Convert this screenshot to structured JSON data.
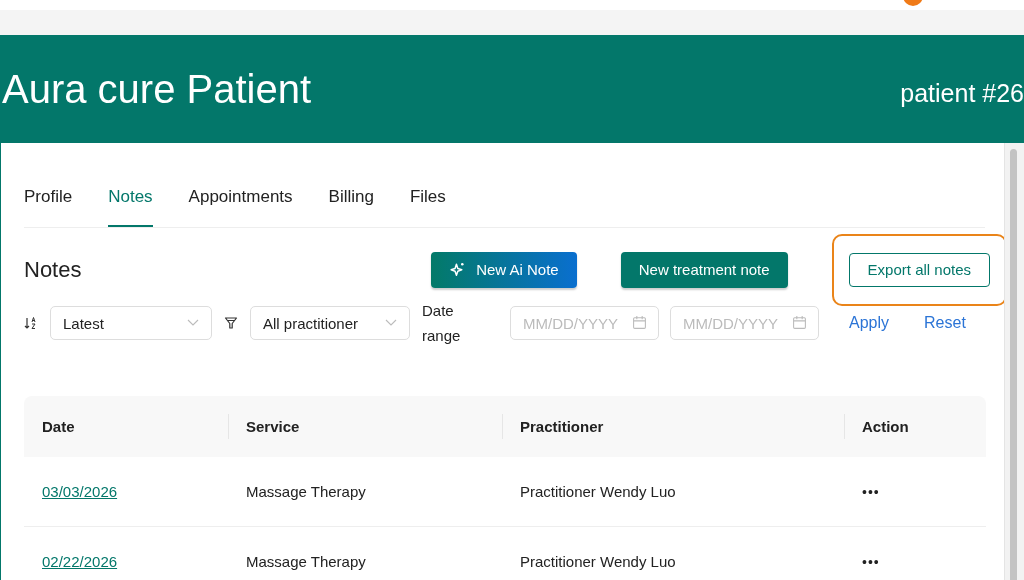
{
  "header": {
    "title": "Aura cure Patient",
    "patient_id": "patient #26"
  },
  "tabs": [
    {
      "label": "Profile",
      "selected": false
    },
    {
      "label": "Notes",
      "selected": true
    },
    {
      "label": "Appointments",
      "selected": false
    },
    {
      "label": "Billing",
      "selected": false
    },
    {
      "label": "Files",
      "selected": false
    }
  ],
  "section_title": "Notes",
  "buttons": [
    {
      "kind": "ai",
      "label": "New Ai Note"
    },
    {
      "kind": "primary",
      "label": "New treatment note"
    },
    {
      "kind": "outline",
      "label": "Export all notes",
      "highlighted": true
    }
  ],
  "filters": {
    "sort": "Latest",
    "practitioner": "All practitioner",
    "date_range_label": "Date range",
    "start_placeholder": "MM/DD/YYYY",
    "end_placeholder": "MM/DD/YYYY",
    "apply": "Apply",
    "reset": "Reset"
  },
  "table": {
    "columns": [
      "Date",
      "Service",
      "Practitioner",
      "Action"
    ],
    "rows": [
      {
        "date": "03/03/2026",
        "service": "Massage Therapy",
        "practitioner": "Practitioner Wendy Luo",
        "action": "•••"
      },
      {
        "date": "02/22/2026",
        "service": "Massage Therapy",
        "practitioner": "Practitioner Wendy Luo",
        "action": "•••"
      }
    ]
  }
}
